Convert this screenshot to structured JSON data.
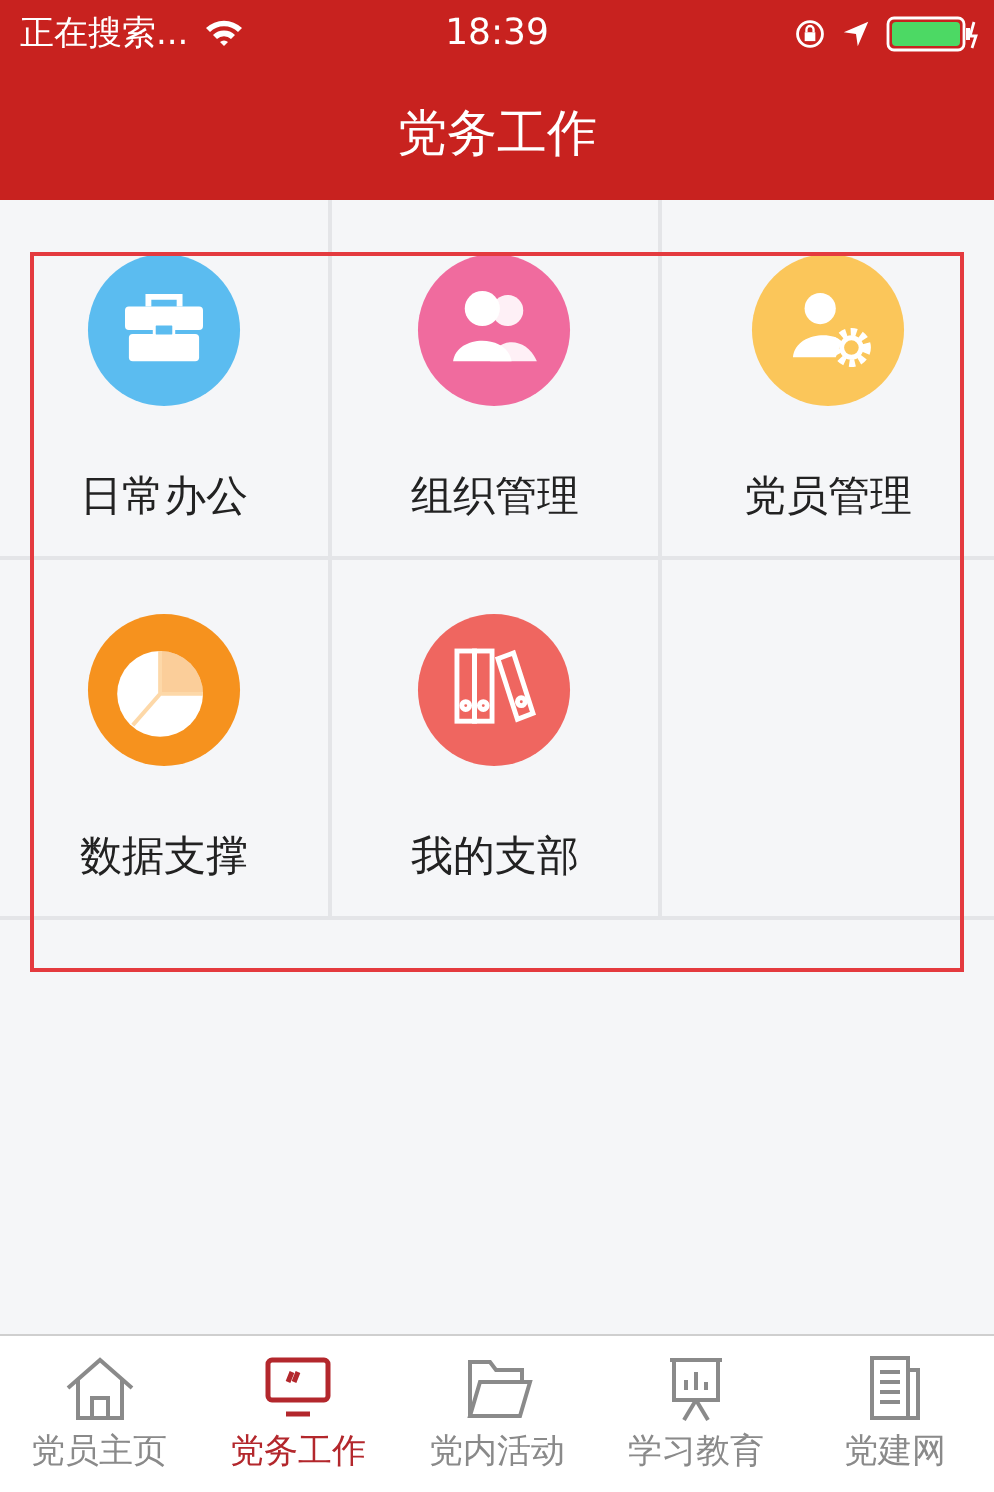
{
  "status_bar": {
    "carrier": "正在搜索...",
    "time": "18:39"
  },
  "nav_bar": {
    "title": "党务工作"
  },
  "grid": [
    {
      "label": "日常办公",
      "kind": "briefcase",
      "color": "#5bbcf0"
    },
    {
      "label": "组织管理",
      "kind": "people",
      "color": "#f06b9e"
    },
    {
      "label": "党员管理",
      "kind": "member",
      "color": "#fbc65a"
    },
    {
      "label": "数据支撑",
      "kind": "chart",
      "color": "#f6921e"
    },
    {
      "label": "我的支部",
      "kind": "binders",
      "color": "#ef6660"
    }
  ],
  "tab_bar": [
    {
      "label": "党员主页",
      "kind": "home",
      "selected": false
    },
    {
      "label": "党务工作",
      "kind": "monitor",
      "selected": true
    },
    {
      "label": "党内活动",
      "kind": "folder",
      "selected": false
    },
    {
      "label": "学习教育",
      "kind": "easel",
      "selected": false
    },
    {
      "label": "党建网",
      "kind": "document",
      "selected": false
    }
  ]
}
